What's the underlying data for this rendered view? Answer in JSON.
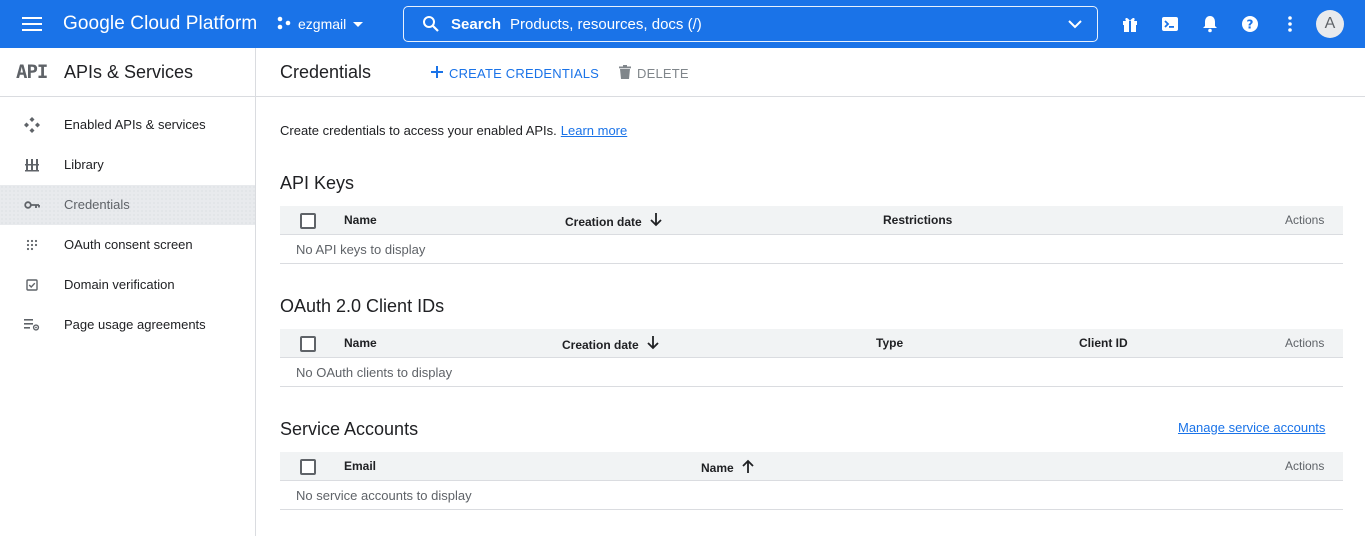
{
  "topbar": {
    "brand": "Google Cloud Platform",
    "project": "ezgmail",
    "search_label": "Search",
    "search_placeholder": "Products, resources, docs (/)",
    "avatar_initial": "A"
  },
  "sidebar": {
    "logo_text": "API",
    "title": "APIs & Services",
    "items": [
      {
        "label": "Enabled APIs & services",
        "icon": "hub-icon"
      },
      {
        "label": "Library",
        "icon": "library-icon"
      },
      {
        "label": "Credentials",
        "icon": "key-icon",
        "active": true
      },
      {
        "label": "OAuth consent screen",
        "icon": "dots-grid-icon"
      },
      {
        "label": "Domain verification",
        "icon": "checkbox-icon"
      },
      {
        "label": "Page usage agreements",
        "icon": "settings-list-icon"
      }
    ]
  },
  "main": {
    "title": "Credentials",
    "create_label": "CREATE CREDENTIALS",
    "delete_label": "DELETE",
    "intro_text": "Create credentials to access your enabled APIs.",
    "learn_more": "Learn more",
    "api_keys": {
      "title": "API Keys",
      "columns": [
        "Name",
        "Creation date",
        "Restrictions",
        "Actions"
      ],
      "empty": "No API keys to display"
    },
    "oauth": {
      "title": "OAuth 2.0 Client IDs",
      "columns": [
        "Name",
        "Creation date",
        "Type",
        "Client ID",
        "Actions"
      ],
      "empty": "No OAuth clients to display"
    },
    "service_accounts": {
      "title": "Service Accounts",
      "manage_link": "Manage service accounts",
      "columns": [
        "Email",
        "Name",
        "Actions"
      ],
      "empty": "No service accounts to display"
    }
  },
  "colors": {
    "brand_blue": "#1a73e8",
    "active_bg": "#e8eaed",
    "border": "#dadce0"
  }
}
